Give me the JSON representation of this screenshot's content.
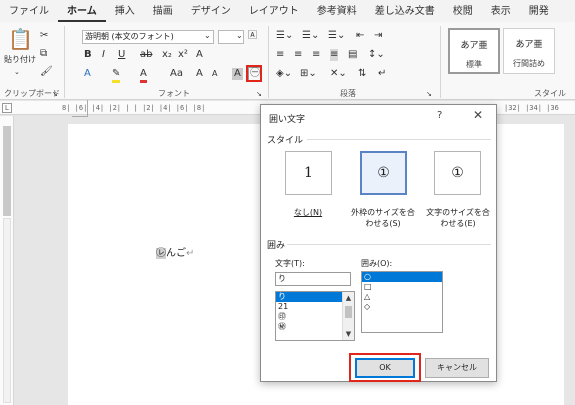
{
  "menu": {
    "tabs": [
      "ファイル",
      "ホーム",
      "挿入",
      "描画",
      "デザイン",
      "レイアウト",
      "参考資料",
      "差し込み文書",
      "校閲",
      "表示",
      "開発"
    ],
    "active_index": 1
  },
  "ribbon": {
    "paste_label": "貼り付け",
    "clipboard_label": "クリップボード",
    "font_name": "游明朝 (本文のフォント)",
    "font_size": "",
    "font_label": "フォント",
    "paragraph_label": "段落",
    "styles_label": "スタイル",
    "styles": [
      {
        "preview": "あア亜",
        "name": "標準"
      },
      {
        "preview": "あア亜",
        "name": "行間詰め"
      }
    ],
    "enclose_icon": "enclosed-character-icon"
  },
  "ruler": {
    "marks": "8| |6| |4| |2| |  | |2| |4| |6| |8|",
    "right": "|32| |34| |36"
  },
  "document": {
    "enclosed": "㋹",
    "rest": "んご"
  },
  "dialog": {
    "title": "囲い文字",
    "help": "?",
    "close": "✕",
    "style_section": "スタイル",
    "styles": [
      {
        "glyph": "1",
        "caption": [
          "なし(N)"
        ]
      },
      {
        "glyph": "①",
        "caption": [
          "外枠のサイズを合",
          "わせる(S)"
        ]
      },
      {
        "glyph": "①",
        "caption": [
          "文字のサイズを合",
          "わせる(E)"
        ]
      }
    ],
    "selected_style": 1,
    "enclosure_section": "囲み",
    "text_label": "文字(T):",
    "text_value": "り",
    "text_list": [
      "り",
      "21",
      "㊞",
      "㊙"
    ],
    "text_selected": 0,
    "enclosure_label": "囲み(O):",
    "enclosure_list": [
      "○",
      "□",
      "△",
      "◇"
    ],
    "enclosure_selected": 0,
    "ok": "OK",
    "cancel": "キャンセル"
  },
  "colors": {
    "accent": "#0078d7",
    "highlight": "#e0261b"
  }
}
